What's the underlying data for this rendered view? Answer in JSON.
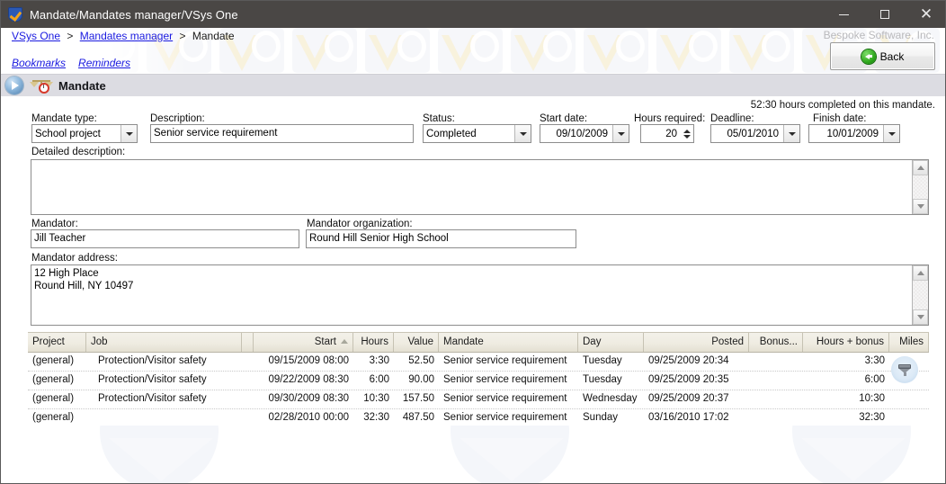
{
  "window": {
    "title": "Mandate/Mandates manager/VSys One",
    "icon": "shield-check-icon",
    "controls": {
      "minimize": "–",
      "maximize": "▢",
      "close": "✕"
    }
  },
  "breadcrumb": {
    "items": [
      {
        "label": "VSys One",
        "link": true
      },
      {
        "label": "Mandates manager",
        "link": true
      },
      {
        "label": "Mandate",
        "link": false
      }
    ],
    "separator": ">"
  },
  "subnav": {
    "items": [
      {
        "label": "Bookmarks"
      },
      {
        "label": "Reminders"
      }
    ]
  },
  "branding": {
    "text": "Bespoke Software, Inc."
  },
  "back_button": {
    "label": "Back",
    "icon": "back-arrow-icon"
  },
  "page_header": {
    "title": "Mandate",
    "icon": "scales-clock-icon",
    "play_icon": "play-orb-icon"
  },
  "form": {
    "hours_note": "52:30 hours completed on this mandate.",
    "mandate_type": {
      "label": "Mandate type:",
      "value": "School project"
    },
    "description": {
      "label": "Description:",
      "value": "Senior service requirement"
    },
    "status": {
      "label": "Status:",
      "value": "Completed"
    },
    "start_date": {
      "label": "Start date:",
      "value": "09/10/2009"
    },
    "hours_required": {
      "label": "Hours required:",
      "value": "20"
    },
    "deadline": {
      "label": "Deadline:",
      "value": "05/01/2010"
    },
    "finish_date": {
      "label": "Finish date:",
      "value": "10/01/2009"
    },
    "detailed_description": {
      "label": "Detailed description:",
      "value": ""
    },
    "mandator": {
      "label": "Mandator:",
      "value": "Jill Teacher"
    },
    "mandator_organization": {
      "label": "Mandator organization:",
      "value": "Round Hill Senior High School"
    },
    "mandator_address": {
      "label": "Mandator address:",
      "value": "12 High Place\nRound Hill, NY 10497"
    }
  },
  "grid": {
    "columns": [
      {
        "key": "project",
        "label": "Project"
      },
      {
        "key": "job",
        "label": "Job"
      },
      {
        "key": "start",
        "label": "Start",
        "sort": "asc"
      },
      {
        "key": "hours",
        "label": "Hours"
      },
      {
        "key": "value",
        "label": "Value"
      },
      {
        "key": "mandate",
        "label": "Mandate"
      },
      {
        "key": "day",
        "label": "Day"
      },
      {
        "key": "posted",
        "label": "Posted"
      },
      {
        "key": "bonus",
        "label": "Bonus..."
      },
      {
        "key": "hours_bonus",
        "label": "Hours + bonus"
      },
      {
        "key": "miles",
        "label": "Miles"
      }
    ],
    "rows": [
      {
        "project": "(general)",
        "job": "Protection/Visitor safety",
        "start": "09/15/2009 08:00",
        "hours": "3:30",
        "value": "52.50",
        "mandate": "Senior service requirement",
        "day": "Tuesday",
        "posted": "09/25/2009 20:34",
        "bonus": "",
        "hours_bonus": "3:30",
        "miles": ""
      },
      {
        "project": "(general)",
        "job": "Protection/Visitor safety",
        "start": "09/22/2009 08:30",
        "hours": "6:00",
        "value": "90.00",
        "mandate": "Senior service requirement",
        "day": "Tuesday",
        "posted": "09/25/2009 20:35",
        "bonus": "",
        "hours_bonus": "6:00",
        "miles": ""
      },
      {
        "project": "(general)",
        "job": "Protection/Visitor safety",
        "start": "09/30/2009 08:30",
        "hours": "10:30",
        "value": "157.50",
        "mandate": "Senior service requirement",
        "day": "Wednesday",
        "posted": "09/25/2009 20:37",
        "bonus": "",
        "hours_bonus": "10:30",
        "miles": ""
      },
      {
        "project": "(general)",
        "job": "",
        "start": "02/28/2010 00:00",
        "hours": "32:30",
        "value": "487.50",
        "mandate": "Senior service requirement",
        "day": "Sunday",
        "posted": "03/16/2010 17:02",
        "bonus": "",
        "hours_bonus": "32:30",
        "miles": ""
      }
    ],
    "filter_icon": "funnel-filter-icon"
  },
  "colors": {
    "titlebar": "#4a4745",
    "link": "#1a1ae0",
    "header_strip": "#dcdce2",
    "grid_header": "#efece2",
    "accent_green": "#2fa81d"
  }
}
